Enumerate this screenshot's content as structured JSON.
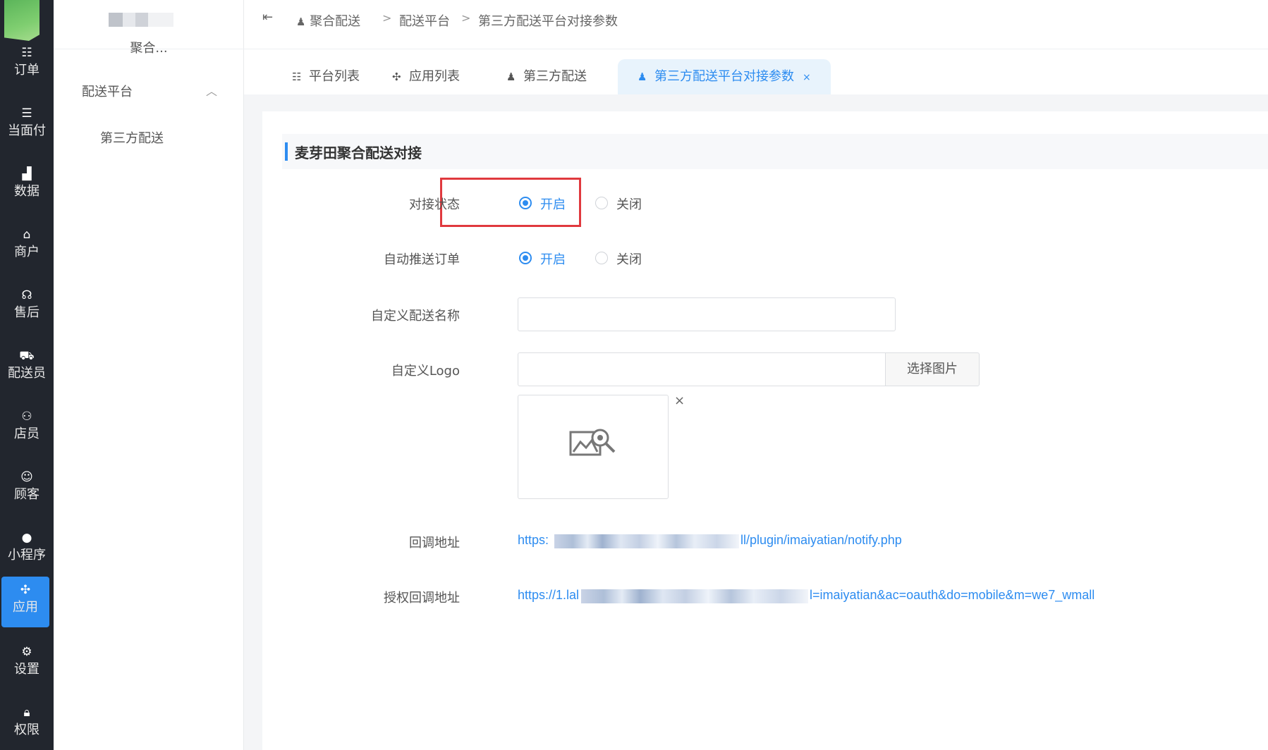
{
  "nav": [
    {
      "label": "订单",
      "icon": "list-icon"
    },
    {
      "label": "当面付",
      "icon": "list-icon"
    },
    {
      "label": "数据",
      "icon": "bar-chart-icon"
    },
    {
      "label": "商户",
      "icon": "store-icon"
    },
    {
      "label": "售后",
      "icon": "headset-icon"
    },
    {
      "label": "配送员",
      "icon": "delivery-icon"
    },
    {
      "label": "店员",
      "icon": "staff-icon"
    },
    {
      "label": "顾客",
      "icon": "customer-icon"
    },
    {
      "label": "小程序",
      "icon": "wechat-icon"
    },
    {
      "label": "应用",
      "icon": "apps-icon",
      "active": true
    },
    {
      "label": "设置",
      "icon": "settings-icon"
    },
    {
      "label": "权限",
      "icon": "lock-icon"
    }
  ],
  "sidebar": {
    "store_name": "聚合...",
    "group_label": "配送平台",
    "sub_item": "第三方配送"
  },
  "breadcrumb": [
    "聚合配送",
    "配送平台",
    "第三方配送平台对接参数"
  ],
  "tabs": [
    {
      "label": "平台列表",
      "icon": "list-icon"
    },
    {
      "label": "应用列表",
      "icon": "apps-icon"
    },
    {
      "label": "第三方配送",
      "icon": "user-group-icon"
    },
    {
      "label": "第三方配送平台对接参数",
      "icon": "user-group-icon",
      "active": true,
      "close": "×"
    }
  ],
  "section_title": "麦芽田聚合配送对接",
  "form": {
    "status_label": "对接状态",
    "status_on": "开启",
    "status_off": "关闭",
    "status_value": "开启",
    "auto_push_label": "自动推送订单",
    "auto_push_on": "开启",
    "auto_push_off": "关闭",
    "auto_push_value": "开启",
    "custom_name_label": "自定义配送名称",
    "custom_name_value": "",
    "custom_logo_label": "自定义Logo",
    "custom_logo_value": "",
    "pick_image_button": "选择图片",
    "image_remove": "×",
    "callback_label": "回调地址",
    "callback_prefix": "https:",
    "callback_suffix": "ll/plugin/imaiyatian/notify.php",
    "auth_callback_label": "授权回调地址",
    "auth_callback_prefix": "https://1.lal",
    "auth_callback_suffix": "l=imaiyatian&ac=oauth&do=mobile&m=we7_wmall"
  },
  "colors": {
    "accent": "#2d8cf0",
    "highlight": "#e0393e",
    "iconbar": "#22262e"
  }
}
